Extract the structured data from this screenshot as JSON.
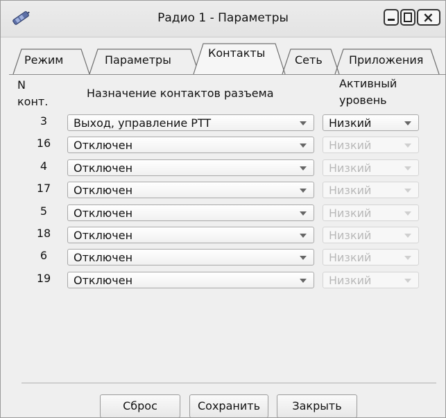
{
  "window": {
    "title": "Радио 1 - Параметры",
    "buttons": {
      "minimize": "minimize",
      "maximize": "maximize",
      "close": "close"
    }
  },
  "tabs": [
    {
      "label": "Режим",
      "active": false
    },
    {
      "label": "Параметры",
      "active": false
    },
    {
      "label": "Контакты",
      "active": true
    },
    {
      "label": "Сеть",
      "active": false
    },
    {
      "label": "Приложения",
      "active": false
    }
  ],
  "headers": {
    "num_line1": "N",
    "num_line2": "конт.",
    "assignment": "Назначение контактов разъема",
    "level_line1": "Активный",
    "level_line2": "уровень"
  },
  "rows": [
    {
      "num": "3",
      "assignment": "Выход, управление PTT",
      "level": "Низкий",
      "level_enabled": true
    },
    {
      "num": "16",
      "assignment": "Отключен",
      "level": "Низкий",
      "level_enabled": false
    },
    {
      "num": "4",
      "assignment": "Отключен",
      "level": "Низкий",
      "level_enabled": false
    },
    {
      "num": "17",
      "assignment": "Отключен",
      "level": "Низкий",
      "level_enabled": false
    },
    {
      "num": "5",
      "assignment": "Отключен",
      "level": "Низкий",
      "level_enabled": false
    },
    {
      "num": "18",
      "assignment": "Отключен",
      "level": "Низкий",
      "level_enabled": false
    },
    {
      "num": "6",
      "assignment": "Отключен",
      "level": "Низкий",
      "level_enabled": false
    },
    {
      "num": "19",
      "assignment": "Отключен",
      "level": "Низкий",
      "level_enabled": false
    }
  ],
  "footer": {
    "reset": "Сброс",
    "save": "Сохранить",
    "close": "Закрыть"
  },
  "icons": {
    "app": "satellite-icon",
    "minimize": "minimize-icon",
    "maximize": "maximize-icon",
    "close": "close-icon",
    "dropdown": "chevron-down-icon"
  },
  "colors": {
    "window_bg": "#efefef",
    "disabled_text": "#b8b8b8"
  }
}
